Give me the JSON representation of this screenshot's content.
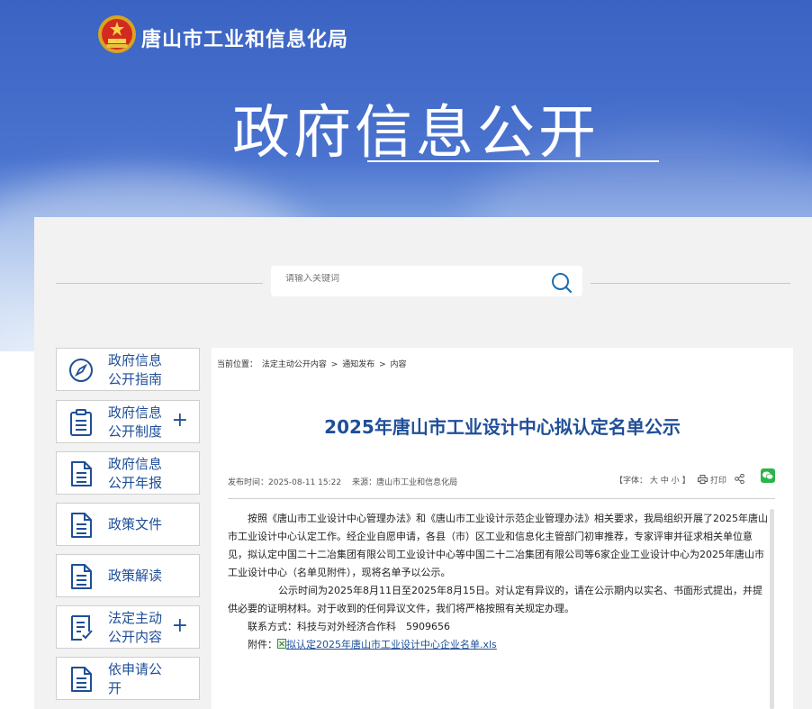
{
  "header": {
    "agency_name": "唐山市工业和信息化局",
    "hero_title": "政府信息公开"
  },
  "search": {
    "placeholder": "请输入关键词"
  },
  "sidebar": {
    "items": [
      {
        "label": "政府信息公开指南",
        "icon": "compass-icon",
        "expandable": false
      },
      {
        "label": "政府信息公开制度",
        "icon": "clipboard-icon",
        "expandable": true
      },
      {
        "label": "政府信息公开年报",
        "icon": "document-icon",
        "expandable": false
      },
      {
        "label": "政策文件",
        "icon": "document-icon",
        "expandable": false
      },
      {
        "label": "政策解读",
        "icon": "document-icon",
        "expandable": false
      },
      {
        "label": "法定主动公开内容",
        "icon": "checklist-icon",
        "expandable": true
      },
      {
        "label": "依申请公开",
        "icon": "document-icon",
        "expandable": false
      }
    ],
    "expand_symbol": "+"
  },
  "breadcrumb": {
    "prefix": "当前位置：",
    "items": [
      "法定主动公开内容",
      "通知发布",
      "内容"
    ],
    "separator": ">"
  },
  "article": {
    "title": "2025年唐山市工业设计中心拟认定名单公示",
    "publish_time_label": "发布时间：",
    "publish_time": "2025-08-11 15:22",
    "source_label": "来源：",
    "source": "唐山市工业和信息化局",
    "font_label": "【字体：",
    "font_sizes": [
      "大",
      "中",
      "小"
    ],
    "font_close": "】",
    "print_label": "打印",
    "paragraphs": [
      "按照《唐山市工业设计中心管理办法》和《唐山市工业设计示范企业管理办法》相关要求，我局组织开展了2025年唐山市工业设计中心认定工作。经企业自愿申请，各县（市）区工业和信息化主管部门初审推荐，专家评审并征求相关单位意见，拟认定中国二十二冶集团有限公司工业设计中心等中国二十二冶集团有限公司等6家企业工业设计中心为2025年唐山市工业设计中心（名单见附件），现将名单予以公示。",
      "公示时间为2025年8月11日至2025年8月15日。对认定有异议的，请在公示期内以实名、书面形式提出，并提供必要的证明材料。对于收到的任何异议文件，我们将严格按照有关规定办理。"
    ],
    "contact_label": "联系方式：",
    "contact_value": "科技与对外经济合作科　5909656",
    "attachment_label": "附件：",
    "attachment_name": "拟认定2025年唐山市工业设计中心企业名单.xls"
  },
  "colors": {
    "brand_blue": "#1f4f98",
    "banner_blue": "#3a63c3",
    "wechat_green": "#2bb44a"
  }
}
